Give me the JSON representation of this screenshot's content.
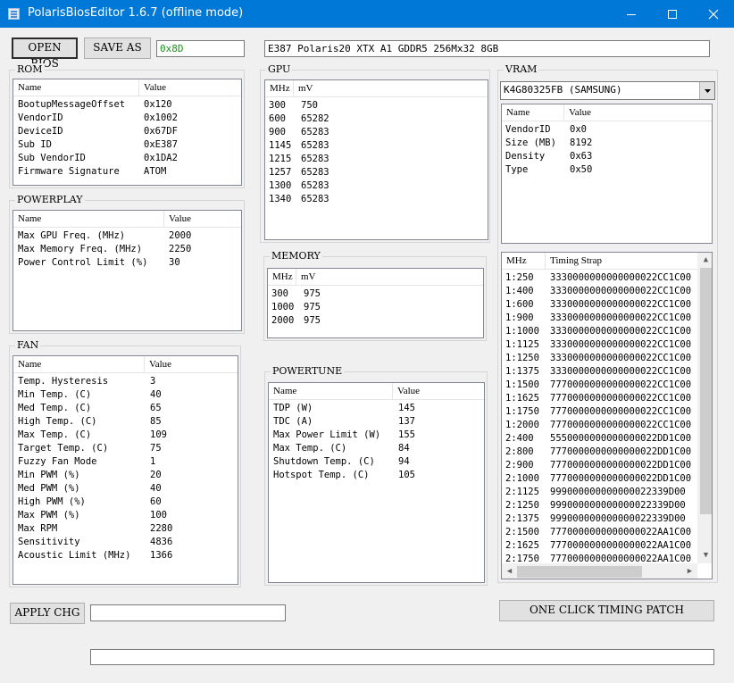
{
  "window": {
    "title": "PolarisBiosEditor 1.6.7 (offline mode)"
  },
  "toolbar": {
    "open_label": "OPEN BIOS",
    "save_label": "SAVE AS",
    "checksum": "0x8D",
    "bios_description": "E387 Polaris20 XTX A1 GDDR5 256Mx32 8GB"
  },
  "rom": {
    "legend": "ROM",
    "columns": [
      "Name",
      "Value"
    ],
    "rows": [
      [
        "BootupMessageOffset",
        "0x120"
      ],
      [
        "VendorID",
        "0x1002"
      ],
      [
        "DeviceID",
        "0x67DF"
      ],
      [
        "Sub ID",
        "0xE387"
      ],
      [
        "Sub VendorID",
        "0x1DA2"
      ],
      [
        "Firmware Signature",
        "ATOM"
      ]
    ]
  },
  "powerplay": {
    "legend": "POWERPLAY",
    "columns": [
      "Name",
      "Value"
    ],
    "rows": [
      [
        "Max GPU Freq. (MHz)",
        "2000"
      ],
      [
        "Max Memory Freq. (MHz)",
        "2250"
      ],
      [
        "Power Control Limit (%)",
        "30"
      ]
    ]
  },
  "fan": {
    "legend": "FAN",
    "columns": [
      "Name",
      "Value"
    ],
    "rows": [
      [
        "Temp. Hysteresis",
        "3"
      ],
      [
        "Min Temp. (C)",
        "40"
      ],
      [
        "Med Temp. (C)",
        "65"
      ],
      [
        "High Temp. (C)",
        "85"
      ],
      [
        "Max Temp. (C)",
        "109"
      ],
      [
        "Target Temp. (C)",
        "75"
      ],
      [
        "Fuzzy Fan Mode",
        "1"
      ],
      [
        "Min PWM (%)",
        "20"
      ],
      [
        "Med PWM (%)",
        "40"
      ],
      [
        "High PWM (%)",
        "60"
      ],
      [
        "Max PWM (%)",
        "100"
      ],
      [
        "Max RPM",
        "2280"
      ],
      [
        "Sensitivity",
        "4836"
      ],
      [
        "Acoustic Limit (MHz)",
        "1366"
      ]
    ]
  },
  "gpu": {
    "legend": "GPU",
    "columns": [
      "MHz",
      "mV"
    ],
    "rows": [
      [
        "300",
        "750"
      ],
      [
        "600",
        "65282"
      ],
      [
        "900",
        "65283"
      ],
      [
        "1145",
        "65283"
      ],
      [
        "1215",
        "65283"
      ],
      [
        "1257",
        "65283"
      ],
      [
        "1300",
        "65283"
      ],
      [
        "1340",
        "65283"
      ]
    ]
  },
  "memory": {
    "legend": "MEMORY",
    "columns": [
      "MHz",
      "mV"
    ],
    "rows": [
      [
        "300",
        "975"
      ],
      [
        "1000",
        "975"
      ],
      [
        "2000",
        "975"
      ]
    ]
  },
  "powertune": {
    "legend": "POWERTUNE",
    "columns": [
      "Name",
      "Value"
    ],
    "rows": [
      [
        "TDP (W)",
        "145"
      ],
      [
        "TDC (A)",
        "137"
      ],
      [
        "Max Power Limit (W)",
        "155"
      ],
      [
        "Max Temp. (C)",
        "84"
      ],
      [
        "Shutdown Temp. (C)",
        "94"
      ],
      [
        "Hotspot Temp. (C)",
        "105"
      ]
    ]
  },
  "vram": {
    "legend": "VRAM",
    "selected_module": "K4G80325FB (SAMSUNG)",
    "columns": [
      "Name",
      "Value"
    ],
    "rows": [
      [
        "VendorID",
        "0x0"
      ],
      [
        "Size (MB)",
        "8192"
      ],
      [
        "Density",
        "0x63"
      ],
      [
        "Type",
        "0x50"
      ]
    ]
  },
  "timings": {
    "columns": [
      "MHz",
      "Timing Strap"
    ],
    "rows": [
      [
        "1:250",
        "3330000000000000022CC1C00"
      ],
      [
        "1:400",
        "3330000000000000022CC1C00"
      ],
      [
        "1:600",
        "3330000000000000022CC1C00"
      ],
      [
        "1:900",
        "3330000000000000022CC1C00"
      ],
      [
        "1:1000",
        "3330000000000000022CC1C00"
      ],
      [
        "1:1125",
        "3330000000000000022CC1C00"
      ],
      [
        "1:1250",
        "3330000000000000022CC1C00"
      ],
      [
        "1:1375",
        "3330000000000000022CC1C00"
      ],
      [
        "1:1500",
        "7770000000000000022CC1C00"
      ],
      [
        "1:1625",
        "7770000000000000022CC1C00"
      ],
      [
        "1:1750",
        "7770000000000000022CC1C00"
      ],
      [
        "1:2000",
        "7770000000000000022CC1C00"
      ],
      [
        "2:400",
        "5550000000000000022DD1C00"
      ],
      [
        "2:800",
        "7770000000000000022DD1C00"
      ],
      [
        "2:900",
        "7770000000000000022DD1C00"
      ],
      [
        "2:1000",
        "7770000000000000022DD1C00"
      ],
      [
        "2:1125",
        "999000000000000022339D00"
      ],
      [
        "2:1250",
        "999000000000000022339D00"
      ],
      [
        "2:1375",
        "999000000000000022339D00"
      ],
      [
        "2:1500",
        "7770000000000000022AA1C00"
      ],
      [
        "2:1625",
        "7770000000000000022AA1C00"
      ],
      [
        "2:1750",
        "7770000000000000022AA1C00"
      ]
    ]
  },
  "footer": {
    "apply_label": "APPLY CHG",
    "one_click_label": "ONE CLICK TIMING PATCH",
    "edit_value": "",
    "status_text": ""
  }
}
